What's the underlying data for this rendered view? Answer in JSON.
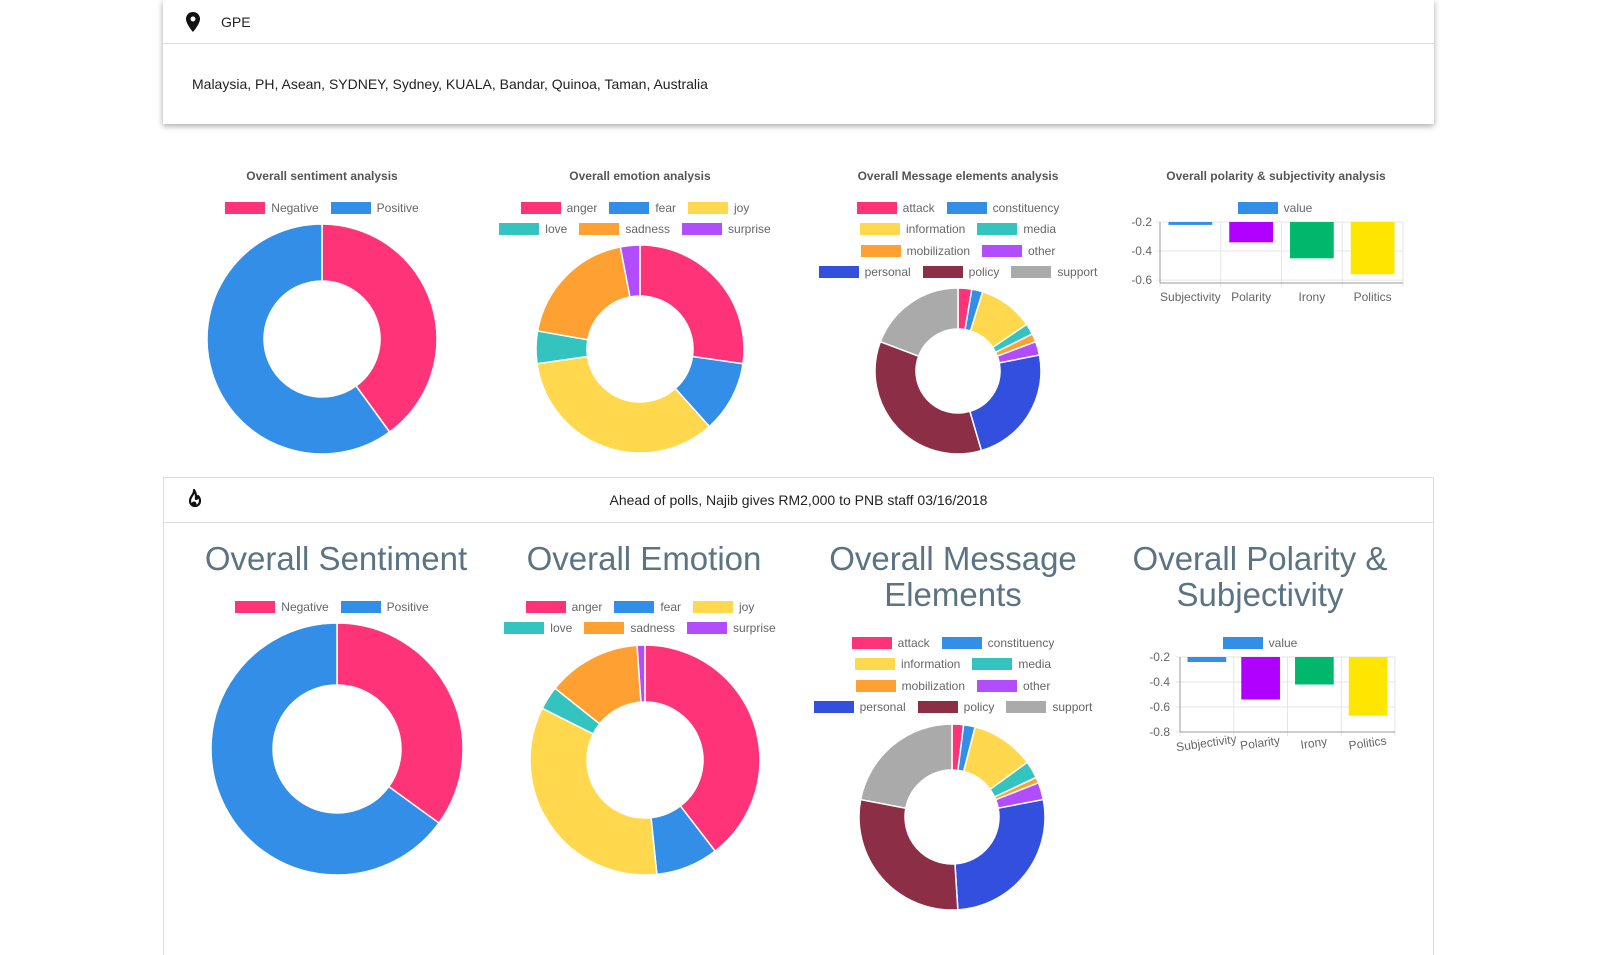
{
  "gpe_card": {
    "label": "GPE",
    "icon": "map-pin-icon",
    "entities": "Malaysia, PH, Asean, SYDNEY, Sydney, KUALA, Bandar, Quinoa, Taman, Australia"
  },
  "overall": {
    "sentiment_title": "Overall sentiment analysis",
    "emotion_title": "Overall emotion analysis",
    "message_title": "Overall Message elements analysis",
    "polarity_title": "Overall polarity & subjectivity analysis"
  },
  "article": {
    "icon": "fire-icon",
    "title": "Ahead of polls, Najib gives RM2,000 to PNB staff 03/16/2018",
    "sentiment_title": "Overall Sentiment",
    "emotion_title": "Overall Emotion",
    "message_title": "Overall Message Elements",
    "polarity_title": "Overall Polarity & Subjectivity"
  },
  "colors": {
    "Negative": "#ff3377",
    "Positive": "#338ee8",
    "anger": "#ff3377",
    "fear": "#338ee8",
    "joy": "#ffd84d",
    "love": "#33c4bf",
    "sadness": "#ffa033",
    "surprise": "#b14dff",
    "attack": "#ff3377",
    "constituency": "#338ee8",
    "information": "#ffd84d",
    "media": "#33c4bf",
    "mobilization": "#ffa033",
    "other": "#b14dff",
    "personal": "#334fdd",
    "policy": "#8c2e46",
    "support": "#aaaaaa",
    "value": "#338ee8",
    "Subjectivity": "#338ee8",
    "Polarity": "#b000ff",
    "Irony": "#00b86b",
    "Politics": "#ffe600"
  },
  "chart_data": [
    {
      "id": "overall_sentiment",
      "type": "pie",
      "title": "Overall sentiment analysis",
      "categories": [
        "Negative",
        "Positive"
      ],
      "values": [
        40,
        60
      ]
    },
    {
      "id": "overall_emotion",
      "type": "pie",
      "title": "Overall emotion analysis",
      "categories": [
        "anger",
        "fear",
        "joy",
        "love",
        "sadness",
        "surprise"
      ],
      "values": [
        27,
        11,
        34,
        5,
        19,
        3
      ]
    },
    {
      "id": "overall_message",
      "type": "pie",
      "title": "Overall Message elements analysis",
      "categories": [
        "attack",
        "constituency",
        "information",
        "media",
        "mobilization",
        "other",
        "personal",
        "policy",
        "support"
      ],
      "values": [
        2.5,
        2,
        10,
        2,
        1.5,
        2.5,
        22,
        33,
        18
      ]
    },
    {
      "id": "overall_polarity",
      "type": "bar",
      "title": "Overall polarity & subjectivity analysis",
      "legend": [
        "value"
      ],
      "categories": [
        "Subjectivity",
        "Polarity",
        "Irony",
        "Politics"
      ],
      "values": [
        -0.22,
        -0.34,
        -0.45,
        -0.56
      ],
      "ylim": [
        -0.62,
        -0.2
      ],
      "yticks": [
        -0.2,
        -0.4,
        -0.6
      ]
    },
    {
      "id": "article_sentiment",
      "type": "pie",
      "title": "Overall Sentiment",
      "categories": [
        "Negative",
        "Positive"
      ],
      "values": [
        35,
        65
      ]
    },
    {
      "id": "article_emotion",
      "type": "pie",
      "title": "Overall Emotion",
      "categories": [
        "anger",
        "fear",
        "joy",
        "love",
        "sadness",
        "surprise"
      ],
      "values": [
        36,
        8,
        31,
        3,
        12,
        1
      ]
    },
    {
      "id": "article_message",
      "type": "pie",
      "title": "Overall Message Elements",
      "categories": [
        "attack",
        "constituency",
        "information",
        "media",
        "mobilization",
        "other",
        "personal",
        "policy",
        "support"
      ],
      "values": [
        2,
        2,
        11,
        3,
        1,
        3,
        27,
        29,
        22
      ]
    },
    {
      "id": "article_polarity",
      "type": "bar",
      "title": "Overall Polarity & Subjectivity",
      "legend": [
        "value"
      ],
      "categories": [
        "Subjectivity",
        "Polarity",
        "Irony",
        "Politics"
      ],
      "values": [
        -0.24,
        -0.54,
        -0.42,
        -0.67
      ],
      "ylim": [
        -0.8,
        -0.2
      ],
      "yticks": [
        -0.2,
        -0.4,
        -0.6,
        -0.8
      ]
    }
  ]
}
